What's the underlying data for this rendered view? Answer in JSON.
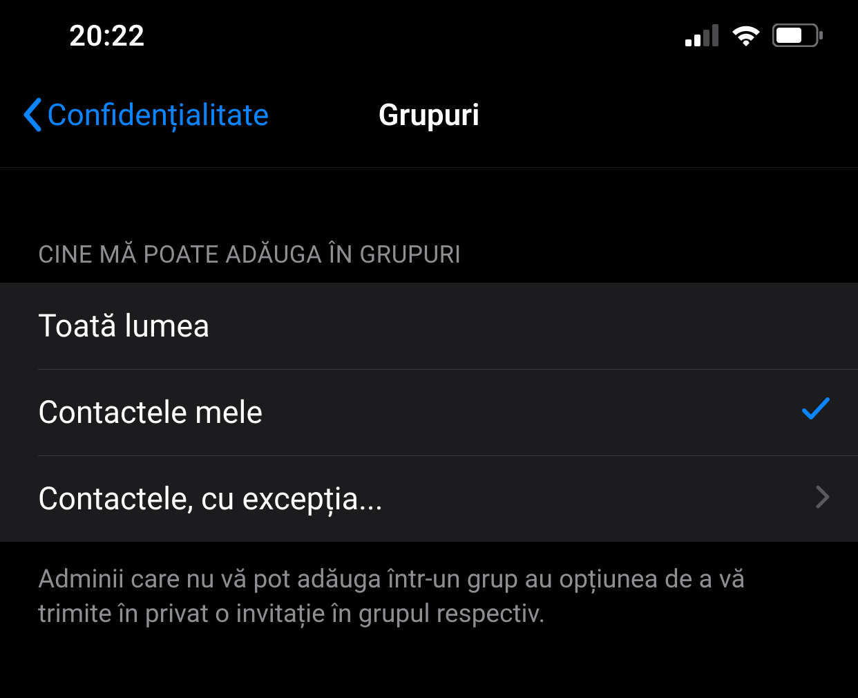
{
  "status": {
    "time": "20:22"
  },
  "nav": {
    "back_label": "Confidențialitate",
    "title": "Grupuri"
  },
  "section": {
    "header": "CINE MĂ POATE ADĂUGA ÎN GRUPURI",
    "options": {
      "everyone": "Toată lumea",
      "my_contacts": "Contactele mele",
      "contacts_except": "Contactele, cu excepția..."
    },
    "selected": "my_contacts",
    "footer": "Adminii care nu vă pot adăuga într-un grup au opțiunea de a vă trimite în privat o invitație în grupul respectiv."
  }
}
